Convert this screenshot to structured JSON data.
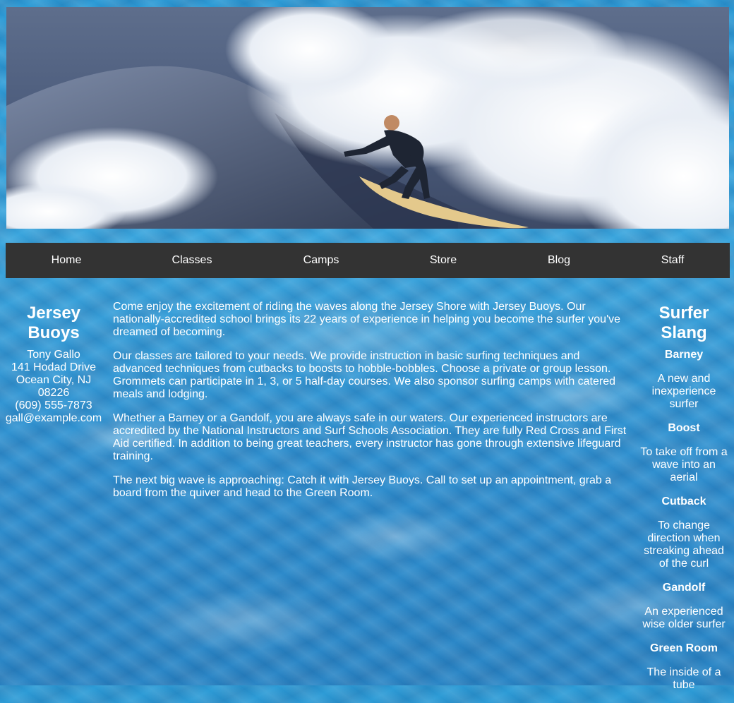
{
  "hero": {
    "alt": "Surfer riding a wave"
  },
  "nav": {
    "items": [
      {
        "label": "Home"
      },
      {
        "label": "Classes"
      },
      {
        "label": "Camps"
      },
      {
        "label": "Store"
      },
      {
        "label": "Blog"
      },
      {
        "label": "Staff"
      }
    ]
  },
  "contact": {
    "title": "Jersey Buoys",
    "name": "Tony Gallo",
    "street": "141 Hodad Drive",
    "city": "Ocean City, NJ",
    "zip": "08226",
    "phone": "(609) 555-7873",
    "email": "gall@example.com"
  },
  "main": {
    "paragraphs": [
      "Come enjoy the excitement of riding the waves along the Jersey Shore with Jersey Buoys. Our nationally-accredited school brings its 22 years of experience in helping you become the surfer you've dreamed of becoming.",
      "Our classes are tailored to your needs. We provide instruction in basic surfing techniques and advanced techniques from cutbacks to boosts to hobble-bobbles. Choose a private or group lesson. Grommets can participate in 1, 3, or 5 half-day courses. We also sponsor surfing camps with catered meals and lodging.",
      "Whether a Barney or a Gandolf, you are always safe in our waters. Our experienced instructors are accredited by the National Instructors and Surf Schools Association. They are fully Red Cross and First Aid certified. In addition to being great teachers, every instructor has gone through extensive lifeguard training.",
      "The next big wave is approaching: Catch it with Jersey Buoys. Call to set up an appointment, grab a board from the quiver and head to the Green Room."
    ]
  },
  "slang": {
    "title": "Surfer Slang",
    "terms": [
      {
        "term": "Barney",
        "definition": "A new and inexperience surfer"
      },
      {
        "term": "Boost",
        "definition": "To take off from a wave into an aerial"
      },
      {
        "term": "Cutback",
        "definition": "To change direction when streaking ahead of the curl"
      },
      {
        "term": "Gandolf",
        "definition": "An experienced wise older surfer"
      },
      {
        "term": "Green Room",
        "definition": "The inside of a tube"
      }
    ]
  },
  "colors": {
    "nav_bg": "#333333",
    "text": "#ffffff",
    "water": "#2c9bd6"
  }
}
